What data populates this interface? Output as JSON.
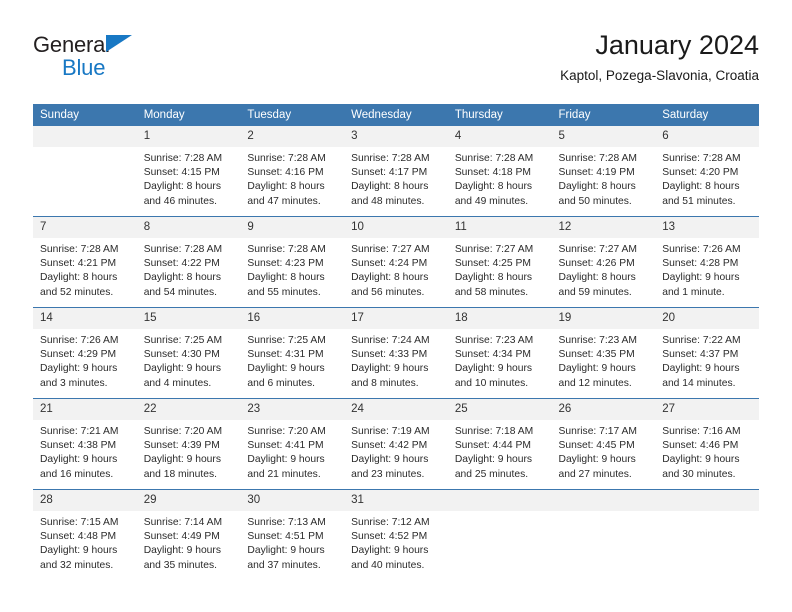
{
  "brand": {
    "name_part1": "General",
    "name_part2": "Blue",
    "accent_color": "#1878c4"
  },
  "header": {
    "title": "January 2024",
    "subtitle": "Kaptol, Pozega-Slavonia, Croatia"
  },
  "theme": {
    "header_bg": "#3c77ae",
    "daynum_bg": "#f2f2f2",
    "text": "#2b2b2b"
  },
  "weekday_headers": [
    "Sunday",
    "Monday",
    "Tuesday",
    "Wednesday",
    "Thursday",
    "Friday",
    "Saturday"
  ],
  "weeks": [
    [
      {
        "day": "",
        "sunrise": "",
        "sunset": "",
        "daylight1": "",
        "daylight2": ""
      },
      {
        "day": "1",
        "sunrise": "Sunrise: 7:28 AM",
        "sunset": "Sunset: 4:15 PM",
        "daylight1": "Daylight: 8 hours",
        "daylight2": "and 46 minutes."
      },
      {
        "day": "2",
        "sunrise": "Sunrise: 7:28 AM",
        "sunset": "Sunset: 4:16 PM",
        "daylight1": "Daylight: 8 hours",
        "daylight2": "and 47 minutes."
      },
      {
        "day": "3",
        "sunrise": "Sunrise: 7:28 AM",
        "sunset": "Sunset: 4:17 PM",
        "daylight1": "Daylight: 8 hours",
        "daylight2": "and 48 minutes."
      },
      {
        "day": "4",
        "sunrise": "Sunrise: 7:28 AM",
        "sunset": "Sunset: 4:18 PM",
        "daylight1": "Daylight: 8 hours",
        "daylight2": "and 49 minutes."
      },
      {
        "day": "5",
        "sunrise": "Sunrise: 7:28 AM",
        "sunset": "Sunset: 4:19 PM",
        "daylight1": "Daylight: 8 hours",
        "daylight2": "and 50 minutes."
      },
      {
        "day": "6",
        "sunrise": "Sunrise: 7:28 AM",
        "sunset": "Sunset: 4:20 PM",
        "daylight1": "Daylight: 8 hours",
        "daylight2": "and 51 minutes."
      }
    ],
    [
      {
        "day": "7",
        "sunrise": "Sunrise: 7:28 AM",
        "sunset": "Sunset: 4:21 PM",
        "daylight1": "Daylight: 8 hours",
        "daylight2": "and 52 minutes."
      },
      {
        "day": "8",
        "sunrise": "Sunrise: 7:28 AM",
        "sunset": "Sunset: 4:22 PM",
        "daylight1": "Daylight: 8 hours",
        "daylight2": "and 54 minutes."
      },
      {
        "day": "9",
        "sunrise": "Sunrise: 7:28 AM",
        "sunset": "Sunset: 4:23 PM",
        "daylight1": "Daylight: 8 hours",
        "daylight2": "and 55 minutes."
      },
      {
        "day": "10",
        "sunrise": "Sunrise: 7:27 AM",
        "sunset": "Sunset: 4:24 PM",
        "daylight1": "Daylight: 8 hours",
        "daylight2": "and 56 minutes."
      },
      {
        "day": "11",
        "sunrise": "Sunrise: 7:27 AM",
        "sunset": "Sunset: 4:25 PM",
        "daylight1": "Daylight: 8 hours",
        "daylight2": "and 58 minutes."
      },
      {
        "day": "12",
        "sunrise": "Sunrise: 7:27 AM",
        "sunset": "Sunset: 4:26 PM",
        "daylight1": "Daylight: 8 hours",
        "daylight2": "and 59 minutes."
      },
      {
        "day": "13",
        "sunrise": "Sunrise: 7:26 AM",
        "sunset": "Sunset: 4:28 PM",
        "daylight1": "Daylight: 9 hours",
        "daylight2": "and 1 minute."
      }
    ],
    [
      {
        "day": "14",
        "sunrise": "Sunrise: 7:26 AM",
        "sunset": "Sunset: 4:29 PM",
        "daylight1": "Daylight: 9 hours",
        "daylight2": "and 3 minutes."
      },
      {
        "day": "15",
        "sunrise": "Sunrise: 7:25 AM",
        "sunset": "Sunset: 4:30 PM",
        "daylight1": "Daylight: 9 hours",
        "daylight2": "and 4 minutes."
      },
      {
        "day": "16",
        "sunrise": "Sunrise: 7:25 AM",
        "sunset": "Sunset: 4:31 PM",
        "daylight1": "Daylight: 9 hours",
        "daylight2": "and 6 minutes."
      },
      {
        "day": "17",
        "sunrise": "Sunrise: 7:24 AM",
        "sunset": "Sunset: 4:33 PM",
        "daylight1": "Daylight: 9 hours",
        "daylight2": "and 8 minutes."
      },
      {
        "day": "18",
        "sunrise": "Sunrise: 7:23 AM",
        "sunset": "Sunset: 4:34 PM",
        "daylight1": "Daylight: 9 hours",
        "daylight2": "and 10 minutes."
      },
      {
        "day": "19",
        "sunrise": "Sunrise: 7:23 AM",
        "sunset": "Sunset: 4:35 PM",
        "daylight1": "Daylight: 9 hours",
        "daylight2": "and 12 minutes."
      },
      {
        "day": "20",
        "sunrise": "Sunrise: 7:22 AM",
        "sunset": "Sunset: 4:37 PM",
        "daylight1": "Daylight: 9 hours",
        "daylight2": "and 14 minutes."
      }
    ],
    [
      {
        "day": "21",
        "sunrise": "Sunrise: 7:21 AM",
        "sunset": "Sunset: 4:38 PM",
        "daylight1": "Daylight: 9 hours",
        "daylight2": "and 16 minutes."
      },
      {
        "day": "22",
        "sunrise": "Sunrise: 7:20 AM",
        "sunset": "Sunset: 4:39 PM",
        "daylight1": "Daylight: 9 hours",
        "daylight2": "and 18 minutes."
      },
      {
        "day": "23",
        "sunrise": "Sunrise: 7:20 AM",
        "sunset": "Sunset: 4:41 PM",
        "daylight1": "Daylight: 9 hours",
        "daylight2": "and 21 minutes."
      },
      {
        "day": "24",
        "sunrise": "Sunrise: 7:19 AM",
        "sunset": "Sunset: 4:42 PM",
        "daylight1": "Daylight: 9 hours",
        "daylight2": "and 23 minutes."
      },
      {
        "day": "25",
        "sunrise": "Sunrise: 7:18 AM",
        "sunset": "Sunset: 4:44 PM",
        "daylight1": "Daylight: 9 hours",
        "daylight2": "and 25 minutes."
      },
      {
        "day": "26",
        "sunrise": "Sunrise: 7:17 AM",
        "sunset": "Sunset: 4:45 PM",
        "daylight1": "Daylight: 9 hours",
        "daylight2": "and 27 minutes."
      },
      {
        "day": "27",
        "sunrise": "Sunrise: 7:16 AM",
        "sunset": "Sunset: 4:46 PM",
        "daylight1": "Daylight: 9 hours",
        "daylight2": "and 30 minutes."
      }
    ],
    [
      {
        "day": "28",
        "sunrise": "Sunrise: 7:15 AM",
        "sunset": "Sunset: 4:48 PM",
        "daylight1": "Daylight: 9 hours",
        "daylight2": "and 32 minutes."
      },
      {
        "day": "29",
        "sunrise": "Sunrise: 7:14 AM",
        "sunset": "Sunset: 4:49 PM",
        "daylight1": "Daylight: 9 hours",
        "daylight2": "and 35 minutes."
      },
      {
        "day": "30",
        "sunrise": "Sunrise: 7:13 AM",
        "sunset": "Sunset: 4:51 PM",
        "daylight1": "Daylight: 9 hours",
        "daylight2": "and 37 minutes."
      },
      {
        "day": "31",
        "sunrise": "Sunrise: 7:12 AM",
        "sunset": "Sunset: 4:52 PM",
        "daylight1": "Daylight: 9 hours",
        "daylight2": "and 40 minutes."
      },
      {
        "day": "",
        "sunrise": "",
        "sunset": "",
        "daylight1": "",
        "daylight2": ""
      },
      {
        "day": "",
        "sunrise": "",
        "sunset": "",
        "daylight1": "",
        "daylight2": ""
      },
      {
        "day": "",
        "sunrise": "",
        "sunset": "",
        "daylight1": "",
        "daylight2": ""
      }
    ]
  ]
}
